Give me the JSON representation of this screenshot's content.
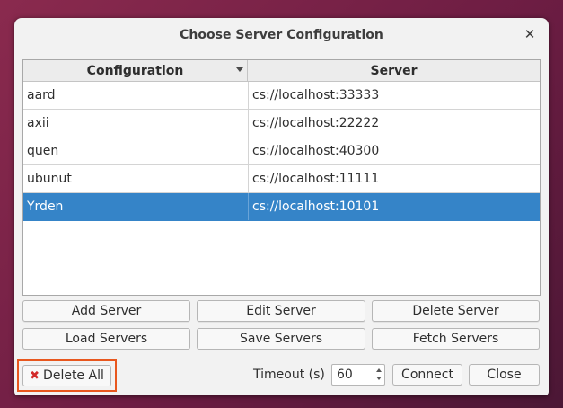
{
  "dialog": {
    "title": "Choose Server Configuration"
  },
  "table": {
    "headers": {
      "configuration": "Configuration",
      "server": "Server"
    },
    "rows": [
      {
        "configuration": "aard",
        "server": "cs://localhost:33333"
      },
      {
        "configuration": "axii",
        "server": "cs://localhost:22222"
      },
      {
        "configuration": "quen",
        "server": "cs://localhost:40300"
      },
      {
        "configuration": "ubunut",
        "server": "cs://localhost:11111"
      },
      {
        "configuration": "Yrden",
        "server": "cs://localhost:10101"
      }
    ],
    "selected_row": "Yrden"
  },
  "buttons": {
    "add_server": "Add Server",
    "edit_server": "Edit Server",
    "delete_server": "Delete Server",
    "load_servers": "Load Servers",
    "save_servers": "Save Servers",
    "fetch_servers": "Fetch Servers",
    "delete_all": "Delete All",
    "connect": "Connect",
    "close": "Close"
  },
  "timeout": {
    "label": "Timeout (s)",
    "value": "60"
  },
  "colors": {
    "selection": "#3584c8",
    "highlight_border": "#e8571e",
    "delete_icon": "#d22a2a"
  },
  "icons": {
    "delete_all": "red-x-icon",
    "close": "close-icon"
  }
}
